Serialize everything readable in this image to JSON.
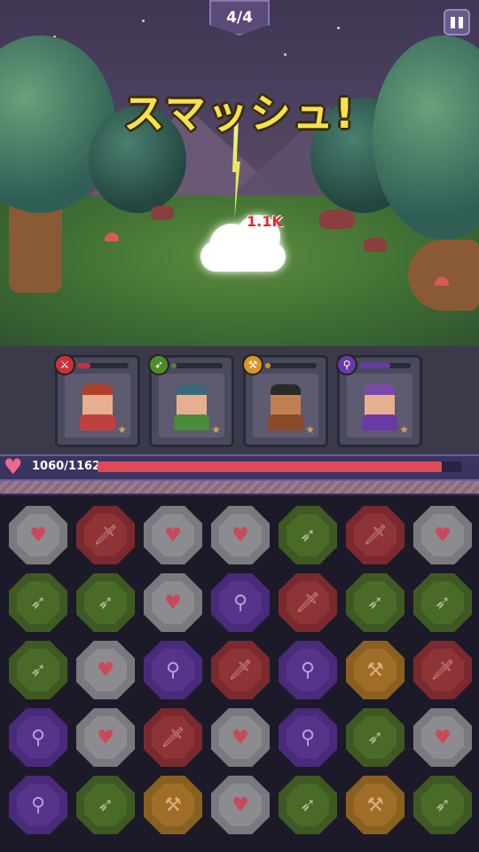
{
  "hud": {
    "wave": "4/4",
    "pause_icon": "pause-icon"
  },
  "battle": {
    "skill_text": "スマッシュ!",
    "damage_text": "1.1K"
  },
  "heroes": [
    {
      "name": "warrior",
      "class_icon": "sword-icon",
      "color": "#c8323a",
      "charge": 0.25,
      "face": "#e6b090",
      "hair": "#b0402a",
      "body": "#c04040",
      "star": "★"
    },
    {
      "name": "archer",
      "class_icon": "arrow-icon",
      "color": "#4f8a2c",
      "charge": 0.1,
      "face": "#e6b090",
      "hair": "#3a6a7a",
      "body": "#4a8a3a",
      "star": "★"
    },
    {
      "name": "pirate",
      "class_icon": "axe-icon",
      "color": "#d6962a",
      "charge": 0.1,
      "face": "#c08050",
      "hair": "#2a2a2a",
      "body": "#8a4a2a",
      "star": "★"
    },
    {
      "name": "mage",
      "class_icon": "staff-icon",
      "color": "#6a3aa8",
      "charge": 0.6,
      "face": "#e6b090",
      "hair": "#7a4aa8",
      "body": "#6a3aa8",
      "star": "★"
    }
  ],
  "party_hp": {
    "current_max": "1060/1162",
    "fraction": 0.946,
    "heart_icon": "heart-icon"
  },
  "board": {
    "types": {
      "heart": {
        "color": "#7a7a7e",
        "inner": "#8c8c90",
        "glyph": "♥",
        "glyph_color": "#c84a5a"
      },
      "sword": {
        "color": "#7a2a2e",
        "inner": "#8e3436",
        "glyph": "🗡",
        "glyph_color": "#c89080"
      },
      "arrow": {
        "color": "#3e5a22",
        "inner": "#4a6a28",
        "glyph": "➶",
        "glyph_color": "#a8c090"
      },
      "staff": {
        "color": "#4a2a7a",
        "inner": "#56348a",
        "glyph": "⚲",
        "glyph_color": "#b8a0d8"
      },
      "axe": {
        "color": "#8a6020",
        "inner": "#9e6e28",
        "glyph": "⚒",
        "glyph_color": "#d8b080"
      }
    },
    "rows": [
      [
        "heart",
        "sword",
        "heart",
        "heart",
        "arrow",
        "sword",
        "heart"
      ],
      [
        "arrow",
        "arrow",
        "heart",
        "staff",
        "sword",
        "arrow",
        "arrow"
      ],
      [
        "arrow",
        "heart",
        "staff",
        "sword",
        "staff",
        "axe",
        "sword"
      ],
      [
        "staff",
        "heart",
        "sword",
        "heart",
        "staff",
        "arrow",
        "heart"
      ],
      [
        "staff",
        "arrow",
        "axe",
        "heart",
        "arrow",
        "axe",
        "arrow"
      ]
    ]
  }
}
